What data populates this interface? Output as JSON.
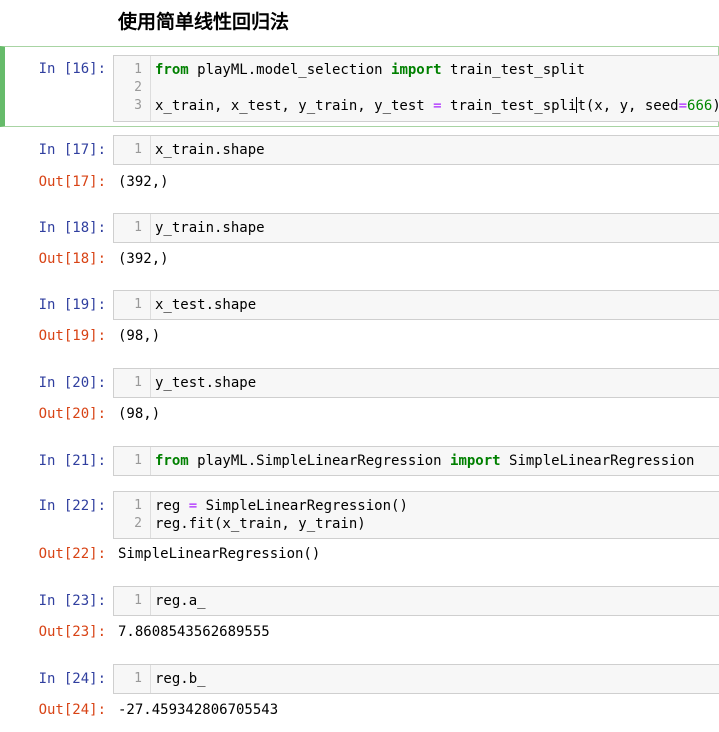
{
  "heading": "使用简单线性回归法",
  "cells": [
    {
      "in_prompt": "In  [16]:",
      "line_numbers": [
        "1",
        "2",
        "3"
      ],
      "line1": {
        "kw_from": "from",
        "module": " playML.model_selection ",
        "kw_import": "import",
        "name": " train_test_split"
      },
      "line3": {
        "lhs": "x_train, x_test, y_train, y_test ",
        "eq": "=",
        "call_a": " train_test_spli",
        "call_b": "t(x, y, seed",
        "eq2": "=",
        "seed": "666",
        "close": ")"
      }
    },
    {
      "in_prompt": "In  [17]:",
      "line_number": "1",
      "code": "x_train.shape",
      "out_prompt": "Out[17]:",
      "output": "(392,)"
    },
    {
      "in_prompt": "In  [18]:",
      "line_number": "1",
      "code": "y_train.shape",
      "out_prompt": "Out[18]:",
      "output": "(392,)"
    },
    {
      "in_prompt": "In  [19]:",
      "line_number": "1",
      "code": "x_test.shape",
      "out_prompt": "Out[19]:",
      "output": "(98,)"
    },
    {
      "in_prompt": "In  [20]:",
      "line_number": "1",
      "code": "y_test.shape",
      "out_prompt": "Out[20]:",
      "output": "(98,)"
    },
    {
      "in_prompt": "In  [21]:",
      "line_number": "1",
      "kw_from": "from",
      "module": " playML.SimpleLinearRegression ",
      "kw_import": "import",
      "name": " SimpleLinearRegression"
    },
    {
      "in_prompt": "In  [22]:",
      "line_numbers": [
        "1",
        "2"
      ],
      "line1": {
        "lhs": "reg ",
        "eq": "=",
        "rhs": " SimpleLinearRegression()"
      },
      "line2": "reg.fit(x_train, y_train)",
      "out_prompt": "Out[22]:",
      "output": "SimpleLinearRegression()"
    },
    {
      "in_prompt": "In  [23]:",
      "line_number": "1",
      "code": "reg.a_",
      "out_prompt": "Out[23]:",
      "output": "7.8608543562689555"
    },
    {
      "in_prompt": "In  [24]:",
      "line_number": "1",
      "code": "reg.b_",
      "out_prompt": "Out[24]:",
      "output": "-27.459342806705543"
    }
  ],
  "colors": {
    "in_prompt": "#303f9f",
    "out_prompt": "#d84315",
    "keyword": "#008000",
    "operator": "#aa22ff",
    "number": "#008800",
    "selected_bar": "#66bb6a"
  }
}
